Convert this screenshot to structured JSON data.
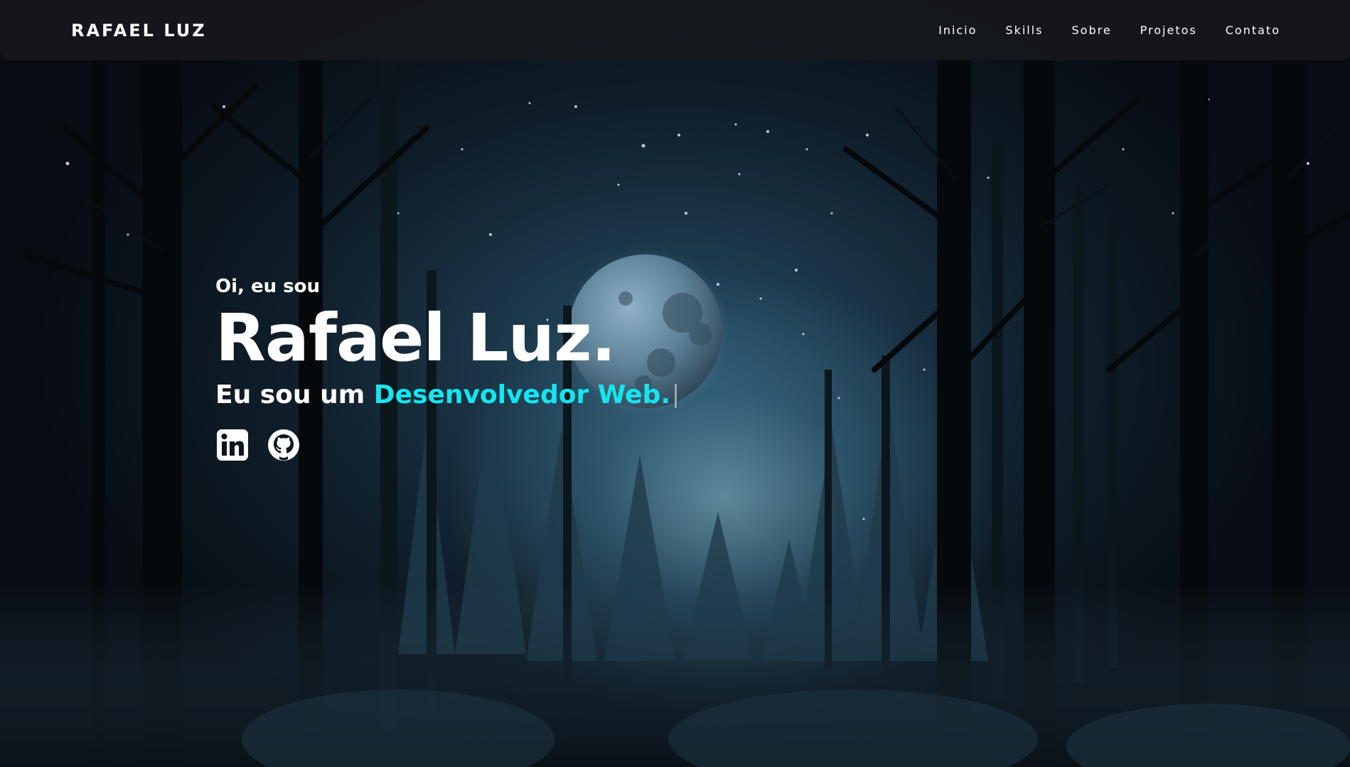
{
  "nav": {
    "brand": "RAFAEL LUZ",
    "links": [
      {
        "label": "Inicio"
      },
      {
        "label": "Skills"
      },
      {
        "label": "Sobre"
      },
      {
        "label": "Projetos"
      },
      {
        "label": "Contato"
      }
    ]
  },
  "hero": {
    "greeting": "Oi, eu sou",
    "name": "Rafael Luz.",
    "tagline_prefix": "Eu sou um",
    "tagline_highlight": "Desenvolvedor Web.",
    "accent_color": "#14e6ef"
  },
  "socials": [
    {
      "icon": "linkedin-icon"
    },
    {
      "icon": "github-icon"
    }
  ],
  "background": {
    "theme": "night forest with moon"
  }
}
